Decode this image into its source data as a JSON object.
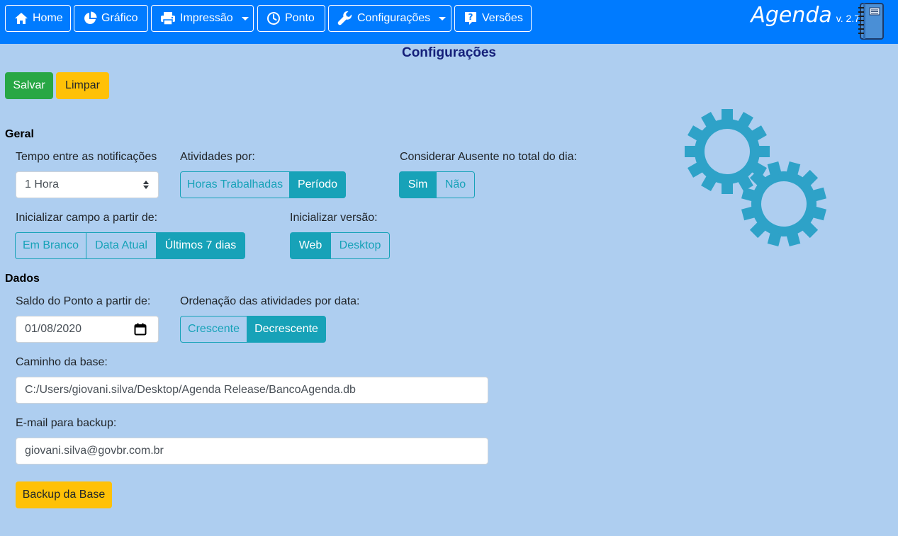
{
  "navbar": {
    "home": "Home",
    "grafico": "Gráfico",
    "impressao": "Impressão",
    "ponto": "Ponto",
    "configuracoes": "Configurações",
    "versoes": "Versões",
    "brand": "Agenda",
    "version": "v. 2.7"
  },
  "page": {
    "title": "Configurações",
    "save": "Salvar",
    "clear": "Limpar"
  },
  "geral": {
    "title": "Geral",
    "notif_label": "Tempo entre as notificações",
    "notif_value": "1 Hora",
    "atividades_label": "Atividades por:",
    "atividades_options": [
      "Horas Trabalhadas",
      "Período"
    ],
    "atividades_selected": "Período",
    "ausente_label": "Considerar Ausente no total do dia:",
    "ausente_options": [
      "Sim",
      "Não"
    ],
    "ausente_selected": "Sim",
    "campo_label": "Inicializar campo a partir de:",
    "campo_options": [
      "Em Branco",
      "Data Atual",
      "Últimos 7 dias"
    ],
    "campo_selected": "Últimos 7 dias",
    "versao_label": "Inicializar versão:",
    "versao_options": [
      "Web",
      "Desktop"
    ],
    "versao_selected": "Web"
  },
  "dados": {
    "title": "Dados",
    "saldo_label": "Saldo do Ponto a partir de:",
    "saldo_value": "01/08/2020",
    "ordenacao_label": "Ordenação das atividades por data:",
    "ordenacao_options": [
      "Crescente",
      "Decrescente"
    ],
    "ordenacao_selected": "Decrescente",
    "caminho_label": "Caminho da base:",
    "caminho_value": "C:/Users/giovani.silva/Desktop/Agenda Release/BancoAgenda.db",
    "email_label": "E-mail para backup:",
    "email_value": "giovani.silva@govbr.com.br",
    "backup_button": "Backup da Base"
  },
  "colors": {
    "navbar": "#007bff",
    "background": "#aecef0",
    "info": "#17a2b8",
    "success": "#28a745",
    "warning": "#ffc107",
    "title": "#15207a"
  },
  "icons": [
    "home-icon",
    "pie-chart-icon",
    "printer-icon",
    "clock-icon",
    "wrench-icon",
    "question-icon",
    "notebook-icon",
    "gears-icon",
    "calendar-icon"
  ]
}
